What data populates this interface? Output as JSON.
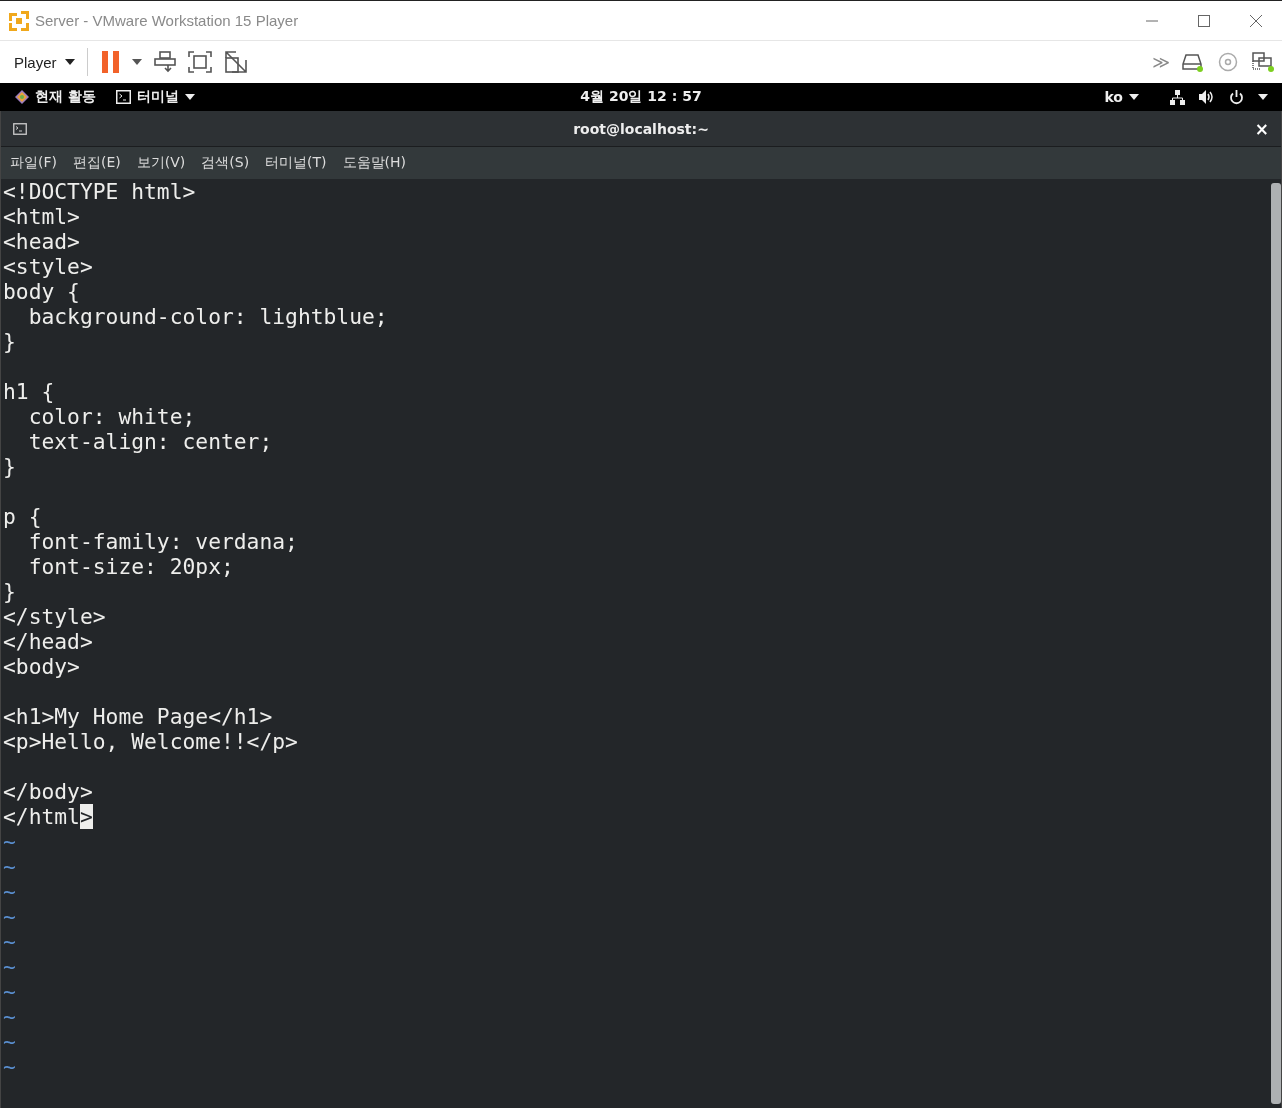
{
  "window": {
    "title": "Server - VMware Workstation 15 Player"
  },
  "toolbar": {
    "player_menu": "Player"
  },
  "device_overflow": "≫",
  "gnome_bar": {
    "activities": "현재 활동",
    "app_menu": "터미널",
    "clock": "4월 20일  12 : 57",
    "input_method": "ko"
  },
  "terminal": {
    "title": "root@localhost:~",
    "close": "×",
    "menu": [
      "파일(F)",
      "편집(E)",
      "보기(V)",
      "검색(S)",
      "터미널(T)",
      "도움말(H)"
    ],
    "lines": [
      {
        "kind": "code",
        "text": "<!DOCTYPE html>"
      },
      {
        "kind": "code",
        "text": "<html>"
      },
      {
        "kind": "code",
        "text": "<head>"
      },
      {
        "kind": "code",
        "text": "<style>"
      },
      {
        "kind": "code",
        "text": "body {"
      },
      {
        "kind": "code",
        "text": "  background-color: lightblue;"
      },
      {
        "kind": "code",
        "text": "}"
      },
      {
        "kind": "blank"
      },
      {
        "kind": "code",
        "text": "h1 {"
      },
      {
        "kind": "code",
        "text": "  color: white;"
      },
      {
        "kind": "code",
        "text": "  text-align: center;"
      },
      {
        "kind": "code",
        "text": "}"
      },
      {
        "kind": "blank"
      },
      {
        "kind": "code",
        "text": "p {"
      },
      {
        "kind": "code",
        "text": "  font-family: verdana;"
      },
      {
        "kind": "code",
        "text": "  font-size: 20px;"
      },
      {
        "kind": "code",
        "text": "}"
      },
      {
        "kind": "code",
        "text": "</style>"
      },
      {
        "kind": "code",
        "text": "</head>"
      },
      {
        "kind": "code",
        "text": "<body>"
      },
      {
        "kind": "blank"
      },
      {
        "kind": "code",
        "text": "<h1>My Home Page</h1>"
      },
      {
        "kind": "code",
        "text": "<p>Hello, Welcome!!</p>"
      },
      {
        "kind": "blank"
      },
      {
        "kind": "code",
        "text": "</body>"
      },
      {
        "kind": "code",
        "text": "</html",
        "cursor_text": ">"
      },
      {
        "kind": "tilde",
        "text": "~"
      },
      {
        "kind": "tilde",
        "text": "~"
      },
      {
        "kind": "tilde",
        "text": "~"
      },
      {
        "kind": "tilde",
        "text": "~"
      },
      {
        "kind": "tilde",
        "text": "~"
      },
      {
        "kind": "tilde",
        "text": "~"
      },
      {
        "kind": "tilde",
        "text": "~"
      },
      {
        "kind": "tilde",
        "text": "~"
      },
      {
        "kind": "tilde",
        "text": "~"
      },
      {
        "kind": "tilde",
        "text": "~"
      }
    ]
  }
}
